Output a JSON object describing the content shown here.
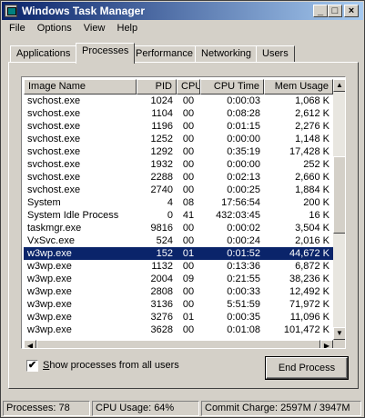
{
  "window": {
    "title": "Windows Task Manager",
    "controls": {
      "minimize": "_",
      "maximize": "□",
      "close": "×"
    }
  },
  "menu": [
    "File",
    "Options",
    "View",
    "Help"
  ],
  "tabs": [
    "Applications",
    "Processes",
    "Performance",
    "Networking",
    "Users"
  ],
  "active_tab": "Processes",
  "columns": [
    "Image Name",
    "PID",
    "CPU",
    "CPU Time",
    "Mem Usage"
  ],
  "rows": [
    [
      "svchost.exe",
      "1024",
      "00",
      "0:00:03",
      "1,068 K"
    ],
    [
      "svchost.exe",
      "1104",
      "00",
      "0:08:28",
      "2,612 K"
    ],
    [
      "svchost.exe",
      "1196",
      "00",
      "0:01:15",
      "2,276 K"
    ],
    [
      "svchost.exe",
      "1252",
      "00",
      "0:00:00",
      "1,148 K"
    ],
    [
      "svchost.exe",
      "1292",
      "00",
      "0:35:19",
      "17,428 K"
    ],
    [
      "svchost.exe",
      "1932",
      "00",
      "0:00:00",
      "252 K"
    ],
    [
      "svchost.exe",
      "2288",
      "00",
      "0:02:13",
      "2,660 K"
    ],
    [
      "svchost.exe",
      "2740",
      "00",
      "0:00:25",
      "1,884 K"
    ],
    [
      "System",
      "4",
      "08",
      "17:56:54",
      "200 K"
    ],
    [
      "System Idle Process",
      "0",
      "41",
      "432:03:45",
      "16 K"
    ],
    [
      "taskmgr.exe",
      "9816",
      "00",
      "0:00:02",
      "3,504 K"
    ],
    [
      "VxSvc.exe",
      "524",
      "00",
      "0:00:24",
      "2,016 K"
    ],
    [
      "w3wp.exe",
      "152",
      "01",
      "0:01:52",
      "44,672 K"
    ],
    [
      "w3wp.exe",
      "1132",
      "00",
      "0:13:36",
      "6,872 K"
    ],
    [
      "w3wp.exe",
      "2004",
      "09",
      "0:21:55",
      "38,236 K"
    ],
    [
      "w3wp.exe",
      "2808",
      "00",
      "0:00:33",
      "12,492 K"
    ],
    [
      "w3wp.exe",
      "3136",
      "00",
      "5:51:59",
      "71,972 K"
    ],
    [
      "w3wp.exe",
      "3276",
      "01",
      "0:00:35",
      "11,096 K"
    ],
    [
      "w3wp.exe",
      "3628",
      "00",
      "0:01:08",
      "101,472 K"
    ]
  ],
  "selected_row": 12,
  "show_all_users": {
    "label_prefix": "S",
    "label_rest": "how processes from all users",
    "checked": "✔"
  },
  "end_process_button": "End Process",
  "status": {
    "processes": "Processes: 78",
    "cpu_usage": "CPU Usage: 64%",
    "commit_charge": "Commit Charge: 2597M / 3947M"
  },
  "scroll_arrows": {
    "up": "▲",
    "down": "▼",
    "left": "◀",
    "right": "▶"
  }
}
